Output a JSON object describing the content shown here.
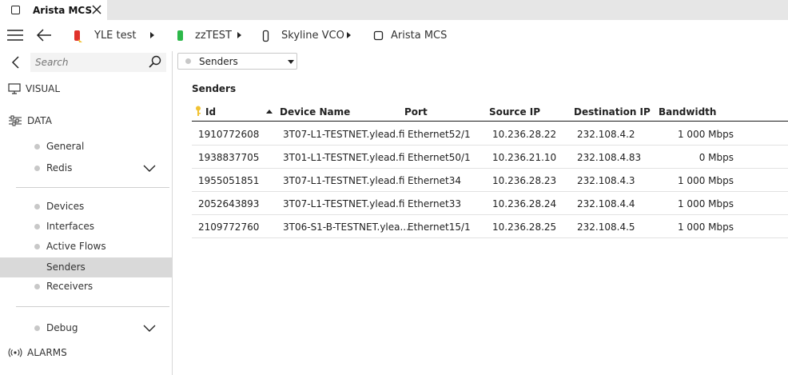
{
  "tab": {
    "title": "Arista MCS"
  },
  "breadcrumbs": [
    {
      "label": "YLE test",
      "icon": "red-status-icon",
      "color": "#e0322b"
    },
    {
      "label": "zzTEST",
      "icon": "green-status-icon",
      "color": "#2db84a"
    },
    {
      "label": "Skyline VCO",
      "icon": "element-outline-icon"
    },
    {
      "label": "Arista MCS",
      "icon": "element-square-icon"
    }
  ],
  "sidebar": {
    "search_placeholder": "Search",
    "visual_label": "VISUAL",
    "data_label": "DATA",
    "alarms_label": "ALARMS",
    "items": {
      "general": "General",
      "redis": "Redis",
      "devices": "Devices",
      "interfaces": "Interfaces",
      "active_flows": "Active Flows",
      "senders": "Senders",
      "receivers": "Receivers",
      "debug": "Debug"
    }
  },
  "main": {
    "dropdown_value": "Senders",
    "panel_title": "Senders",
    "columns": {
      "id": "Id",
      "device_name": "Device Name",
      "port": "Port",
      "source_ip": "Source IP",
      "destination_ip": "Destination IP",
      "bandwidth": "Bandwidth"
    },
    "rows": [
      {
        "id": "1910772608",
        "device_name": "3T07-L1-TESTNET.ylead.fi",
        "port": "Ethernet52/1",
        "source_ip": "10.236.28.22",
        "destination_ip": "232.108.4.2",
        "bandwidth": "1 000 Mbps"
      },
      {
        "id": "1938837705",
        "device_name": "3T01-L1-TESTNET.ylead.fi",
        "port": "Ethernet50/1",
        "source_ip": "10.236.21.10",
        "destination_ip": "232.108.4.83",
        "bandwidth": "0 Mbps"
      },
      {
        "id": "1955051851",
        "device_name": "3T07-L1-TESTNET.ylead.fi",
        "port": "Ethernet34",
        "source_ip": "10.236.28.23",
        "destination_ip": "232.108.4.3",
        "bandwidth": "1 000 Mbps"
      },
      {
        "id": "2052643893",
        "device_name": "3T07-L1-TESTNET.ylead.fi",
        "port": "Ethernet33",
        "source_ip": "10.236.28.24",
        "destination_ip": "232.108.4.4",
        "bandwidth": "1 000 Mbps"
      },
      {
        "id": "2109772760",
        "device_name": "3T06-S1-B-TESTNET.ylea...",
        "port": "Ethernet15/1",
        "source_ip": "10.236.28.25",
        "destination_ip": "232.108.4.5",
        "bandwidth": "1 000 Mbps"
      }
    ]
  }
}
